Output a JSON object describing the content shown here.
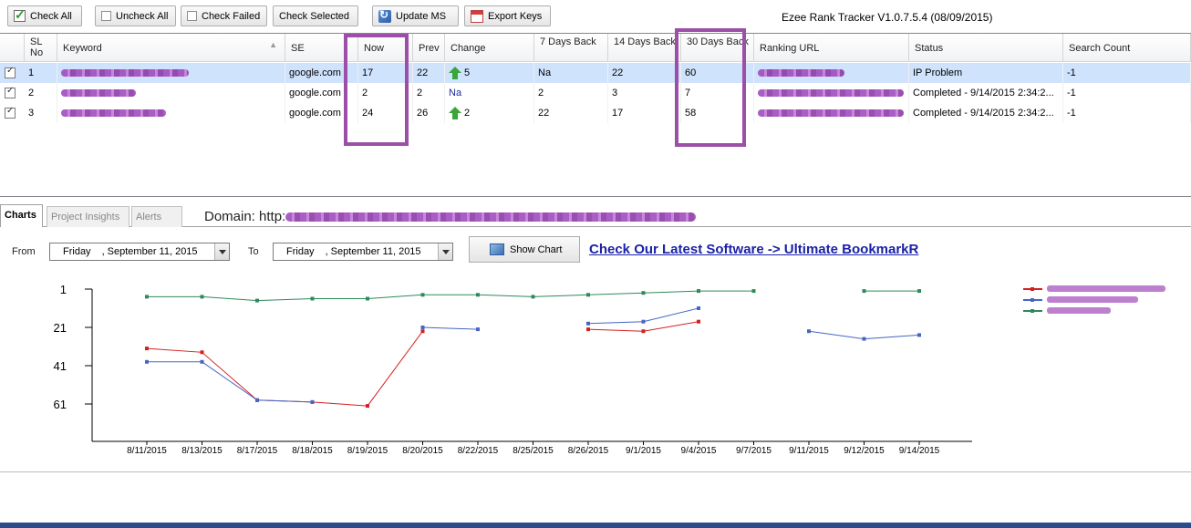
{
  "toolbar": {
    "check_all": "Check All",
    "uncheck_all": "Uncheck All",
    "check_failed": "Check Failed",
    "check_selected": "Check Selected",
    "update_ms": "Update MS",
    "export_keys": "Export Keys",
    "app_title": "Ezee Rank Tracker V1.0.7.5.4 (08/09/2015)"
  },
  "grid": {
    "headers": {
      "sl": "SL No",
      "keyword": "Keyword",
      "se": "SE",
      "now": "Now",
      "prev": "Prev",
      "change": "Change",
      "d7": "7 Days Back",
      "d14": "14 Days Back",
      "d30": "30 Days Back",
      "url": "Ranking URL",
      "status": "Status",
      "count": "Search Count"
    },
    "rows": [
      {
        "sl": "1",
        "se": "google.com",
        "now": "17",
        "prev": "22",
        "change": "5",
        "d7": "Na",
        "d14": "22",
        "d30": "60",
        "status": "IP Problem",
        "count": "-1"
      },
      {
        "sl": "2",
        "se": "google.com",
        "now": "2",
        "prev": "2",
        "change": "Na",
        "d7": "2",
        "d14": "3",
        "d30": "7",
        "status": "Completed - 9/14/2015 2:34:2...",
        "count": "-1"
      },
      {
        "sl": "3",
        "se": "google.com",
        "now": "24",
        "prev": "26",
        "change": "2",
        "d7": "22",
        "d14": "17",
        "d30": "58",
        "status": "Completed - 9/14/2015 2:34:2...",
        "count": "-1"
      }
    ]
  },
  "tabs": {
    "charts": "Charts",
    "insights": "Project Insights",
    "alerts": "Alerts"
  },
  "domain_label": "Domain: http:",
  "chart_controls": {
    "from_label": "From",
    "to_label": "To",
    "from_day": "Friday",
    "from_date": ", September 11, 2015",
    "to_day": "Friday",
    "to_date": ", September 11, 2015",
    "show_chart": "Show Chart",
    "promo": "Check Our Latest Software -> Ultimate BookmarkR"
  },
  "chart_data": {
    "type": "line",
    "categories": [
      "8/11/2015",
      "8/13/2015",
      "8/17/2015",
      "8/18/2015",
      "8/19/2015",
      "8/20/2015",
      "8/22/2015",
      "8/25/2015",
      "8/26/2015",
      "9/1/2015",
      "9/4/2015",
      "9/7/2015",
      "9/11/2015",
      "9/12/2015",
      "9/14/2015"
    ],
    "y_ticks": [
      1,
      21,
      41,
      61
    ],
    "ylim": [
      1,
      80
    ],
    "y_inverted": true,
    "legend_position": "top-right",
    "series": [
      {
        "color": "#d42020",
        "values": [
          32,
          34,
          59,
          60,
          62,
          23,
          null,
          null,
          22,
          23,
          18,
          null,
          null,
          null,
          null
        ]
      },
      {
        "color": "#4466c4",
        "values": [
          39,
          39,
          59,
          60,
          null,
          21,
          22,
          null,
          19,
          18,
          11,
          null,
          23,
          27,
          25
        ]
      },
      {
        "color": "#2e8a5a",
        "values": [
          5,
          5,
          7,
          6,
          6,
          4,
          4,
          5,
          4,
          3,
          2,
          2,
          null,
          2,
          2
        ]
      }
    ]
  }
}
